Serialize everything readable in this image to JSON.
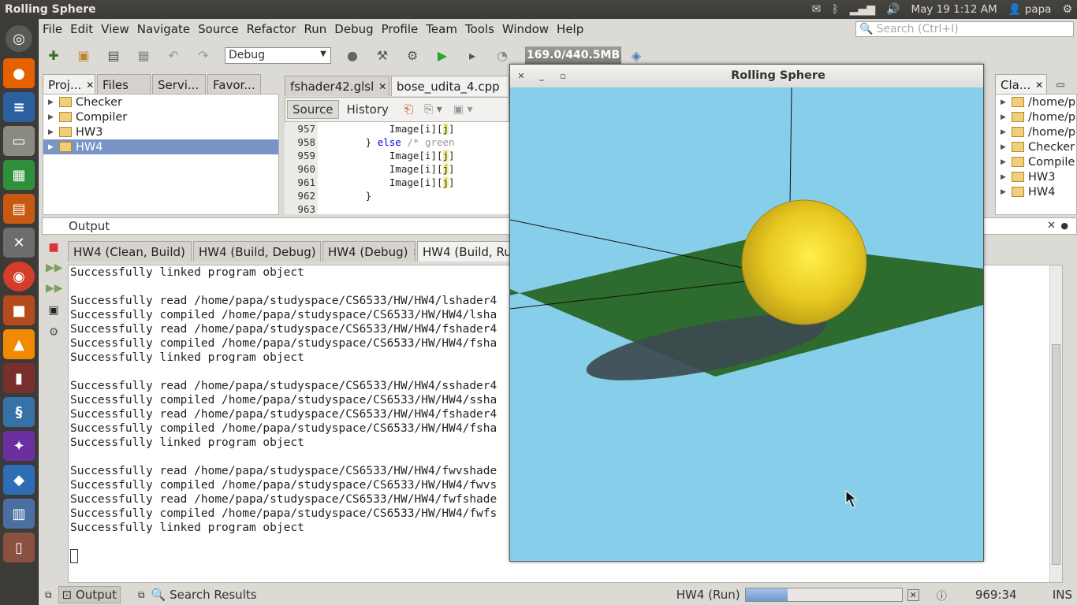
{
  "topbar": {
    "title": "Rolling Sphere",
    "datetime": "May 19  1:12 AM",
    "user": "papa"
  },
  "menu": {
    "items": [
      "File",
      "Edit",
      "View",
      "Navigate",
      "Source",
      "Refactor",
      "Run",
      "Debug",
      "Profile",
      "Team",
      "Tools",
      "Window",
      "Help"
    ],
    "search_placeholder": "Search (Ctrl+I)"
  },
  "toolbar": {
    "config": "Debug",
    "memory": "169.0/440.5MB"
  },
  "projects": {
    "tabs": [
      "Proj...",
      "Files",
      "Servi...",
      "Favor..."
    ],
    "items": [
      "Checker",
      "Compiler",
      "HW3",
      "HW4"
    ],
    "selected": 3
  },
  "editor": {
    "tabs": [
      "fshader42.glsl",
      "bose_udita_4.cpp"
    ],
    "subtabs": [
      "Source",
      "History"
    ],
    "line_numbers": [
      "957",
      "958",
      "959",
      "960",
      "961",
      "962",
      "963"
    ]
  },
  "classes": {
    "tab": "Cla...",
    "items": [
      "/home/p",
      "/home/p",
      "/home/p",
      "Checker",
      "Compile",
      "HW3",
      "HW4"
    ]
  },
  "output": {
    "title": "Output",
    "tabs": [
      "HW4 (Clean, Build)",
      "HW4 (Build, Debug)",
      "HW4 (Debug)",
      "HW4 (Build, Run)"
    ],
    "lines": [
      "Successfully linked program object",
      "",
      "Successfully read /home/papa/studyspace/CS6533/HW/HW4/lshader4",
      "Successfully compiled /home/papa/studyspace/CS6533/HW/HW4/lsha",
      "Successfully read /home/papa/studyspace/CS6533/HW/HW4/fshader4",
      "Successfully compiled /home/papa/studyspace/CS6533/HW/HW4/fsha",
      "Successfully linked program object",
      "",
      "Successfully read /home/papa/studyspace/CS6533/HW/HW4/sshader4",
      "Successfully compiled /home/papa/studyspace/CS6533/HW/HW4/ssha",
      "Successfully read /home/papa/studyspace/CS6533/HW/HW4/fshader4",
      "Successfully compiled /home/papa/studyspace/CS6533/HW/HW4/fsha",
      "Successfully linked program object",
      "",
      "Successfully read /home/papa/studyspace/CS6533/HW/HW4/fwvshade",
      "Successfully compiled /home/papa/studyspace/CS6533/HW/HW4/fwvs",
      "Successfully read /home/papa/studyspace/CS6533/HW/HW4/fwfshade",
      "Successfully compiled /home/papa/studyspace/CS6533/HW/HW4/fwfs",
      "Successfully linked program object"
    ]
  },
  "status": {
    "output_tab": "Output",
    "search_tab": "Search Results",
    "task": "HW4 (Run)",
    "progress": 0.27,
    "position": "969:34",
    "mode": "INS"
  },
  "window": {
    "title": "Rolling Sphere"
  }
}
